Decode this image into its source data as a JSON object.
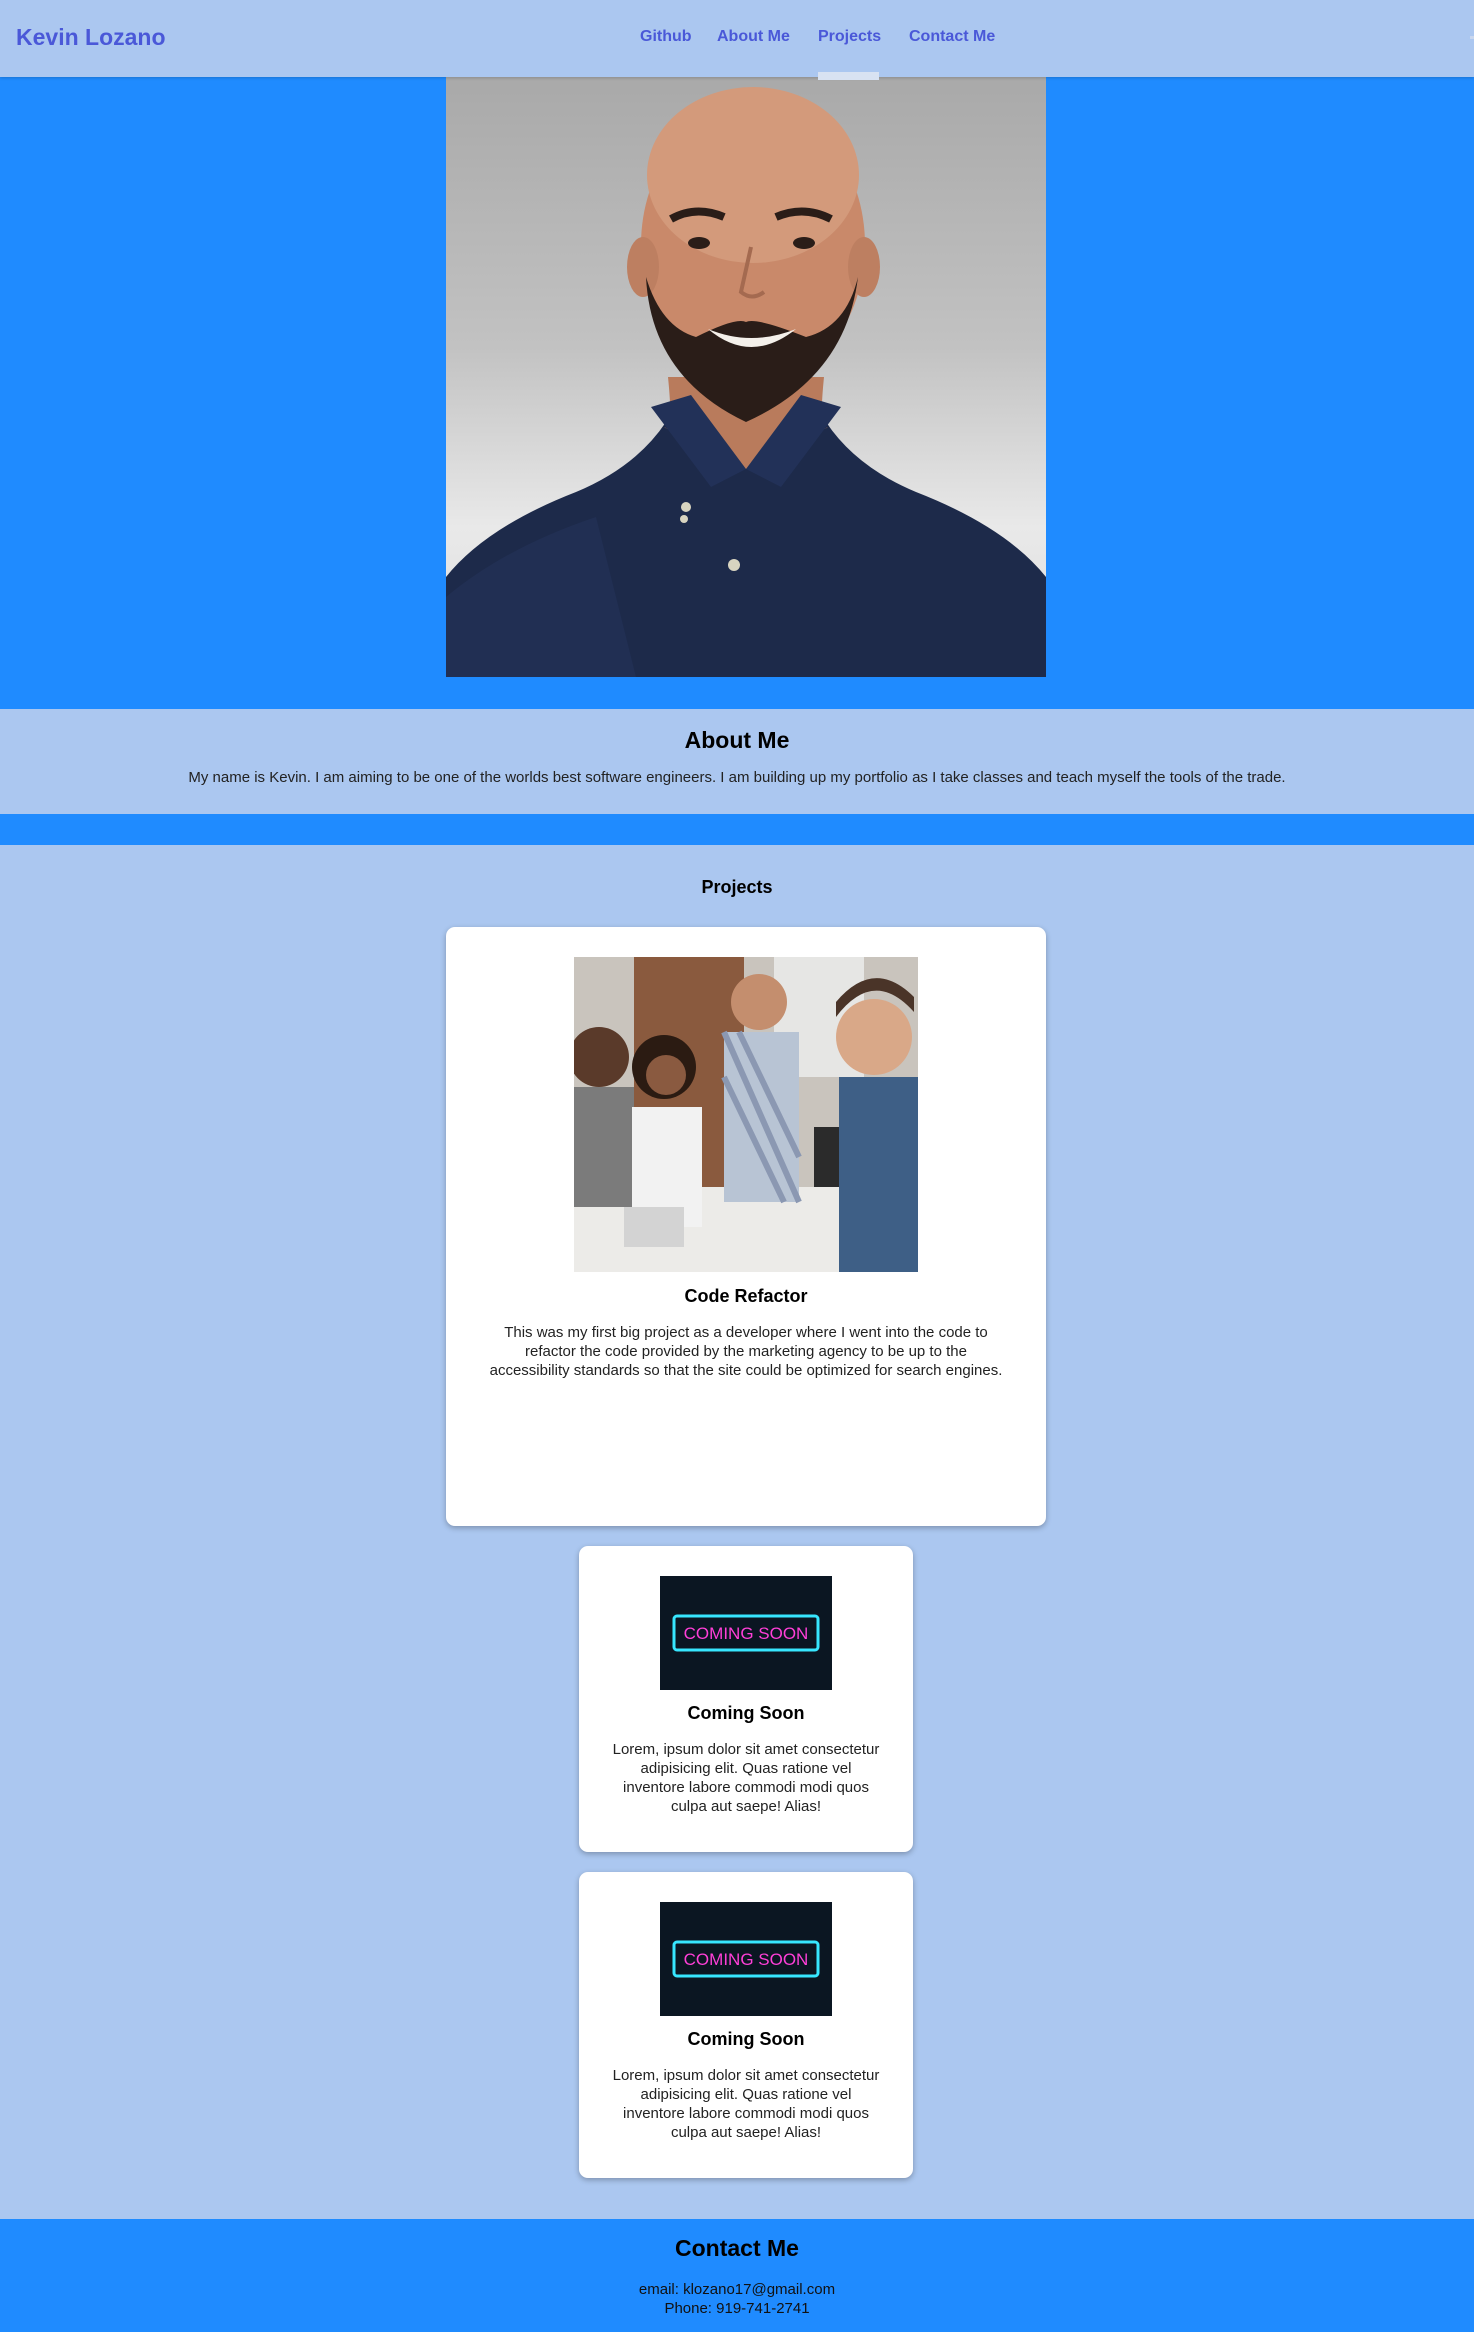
{
  "header": {
    "brand": "Kevin Lozano",
    "nav": [
      {
        "label": "Github"
      },
      {
        "label": "About Me"
      },
      {
        "label": "Projects"
      },
      {
        "label": "Contact Me"
      }
    ],
    "active_nav": "Projects"
  },
  "hero": {
    "image": "portrait-photo"
  },
  "about": {
    "title": "About Me",
    "text": "My name is Kevin. I am aiming to be one of the worlds best software engineers. I am building up my portfolio as I take classes and teach myself the tools of the trade."
  },
  "projects": {
    "title": "Projects",
    "items": [
      {
        "image": "team-meeting-photo",
        "title": "Code Refactor",
        "description": "This was my first big project as a developer where I went into the code to refactor the code provided by the marketing agency to be up to the accessibility standards so that the site could be optimized for search engines."
      },
      {
        "image": "coming-soon-neon-sign",
        "sign_text": "COMING SOON",
        "title": "Coming Soon",
        "description": "Lorem, ipsum dolor sit amet consectetur adipisicing elit. Quas ratione vel inventore labore commodi modi quos culpa aut saepe! Alias!"
      },
      {
        "image": "coming-soon-neon-sign",
        "sign_text": "COMING SOON",
        "title": "Coming Soon",
        "description": "Lorem, ipsum dolor sit amet consectetur adipisicing elit. Quas ratione vel inventore labore commodi modi quos culpa aut saepe! Alias!"
      }
    ]
  },
  "contact": {
    "title": "Contact Me",
    "email": "email: klozano17@gmail.com",
    "phone": "Phone: 919-741-2741"
  },
  "colors": {
    "accent_blue": "#1f8bff",
    "light_blue": "#abc7f0",
    "nav_text": "#4a58d8",
    "neon_pink": "#ff3fd8",
    "neon_cyan": "#37e6ff"
  }
}
